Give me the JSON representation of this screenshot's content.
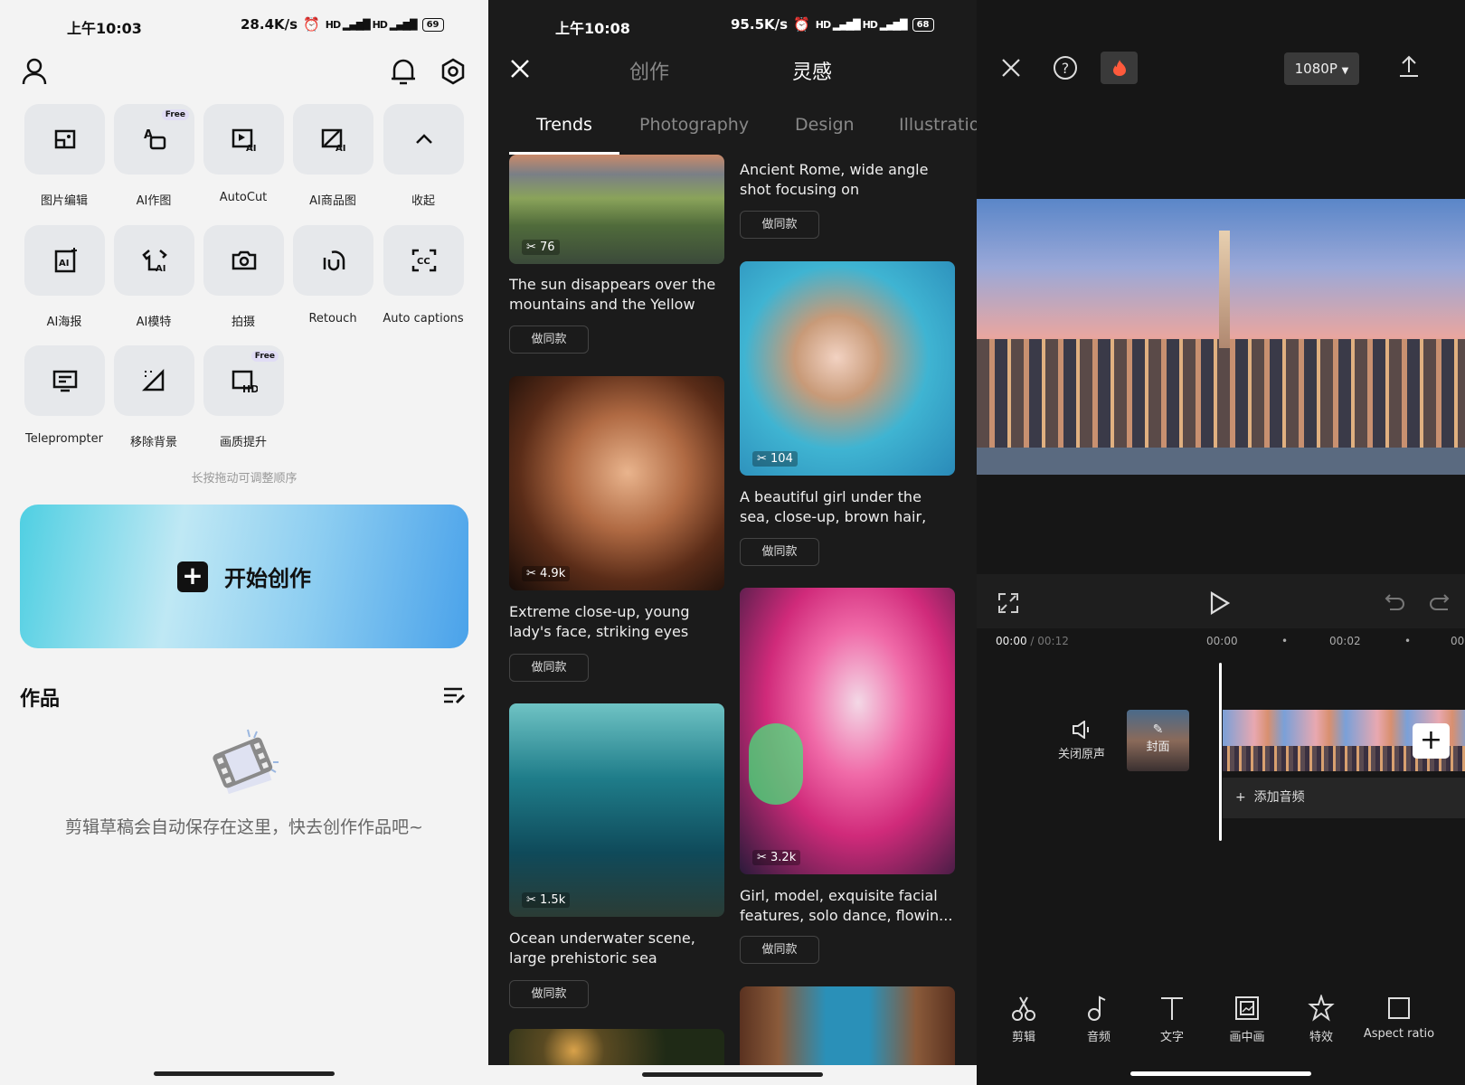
{
  "left": {
    "status": {
      "time": "上午10:03",
      "speed": "28.4K/s",
      "battery": "69"
    },
    "tools": [
      {
        "label": "图片编辑",
        "icon": "image-edit-icon",
        "free": false
      },
      {
        "label": "AI作图",
        "icon": "ai-draw-icon",
        "free": true
      },
      {
        "label": "AutoCut",
        "icon": "autocut-icon",
        "free": false
      },
      {
        "label": "AI商品图",
        "icon": "ai-product-icon",
        "free": false
      },
      {
        "label": "收起",
        "icon": "chevron-up-icon",
        "free": false
      },
      {
        "label": "AI海报",
        "icon": "ai-poster-icon",
        "free": false
      },
      {
        "label": "AI模特",
        "icon": "ai-model-icon",
        "free": false
      },
      {
        "label": "拍摄",
        "icon": "camera-icon",
        "free": false
      },
      {
        "label": "Retouch",
        "icon": "retouch-icon",
        "free": false
      },
      {
        "label": "Auto captions",
        "icon": "captions-icon",
        "free": false
      },
      {
        "label": "Teleprompter",
        "icon": "teleprompter-icon",
        "free": false
      },
      {
        "label": "移除背景",
        "icon": "remove-bg-icon",
        "free": false
      },
      {
        "label": "画质提升",
        "icon": "hd-enhance-icon",
        "free": true
      }
    ],
    "free_badge": "Free",
    "hint": "长按拖动可调整顺序",
    "start_button": "开始创作",
    "works_title": "作品",
    "empty_text": "剪辑草稿会自动保存在这里，快去创作作品吧~"
  },
  "middle": {
    "status": {
      "time": "上午10:08",
      "speed": "95.5K/s",
      "battery": "68"
    },
    "header_tabs": [
      "创作",
      "灵感"
    ],
    "active_header_tab": "灵感",
    "category_tabs": [
      "Trends",
      "Photography",
      "Design",
      "Illustratio"
    ],
    "active_category": "Trends",
    "make_same_label": "做同款",
    "left_cards": [
      {
        "count": "76",
        "text": "The sun disappears over the mountains and the Yellow Ri..."
      },
      {
        "count": "4.9k",
        "text": "Extreme close-up, young lady's face, striking eyes an..."
      },
      {
        "count": "1.5k",
        "text": "Ocean underwater scene, large prehistoric sea creatur..."
      }
    ],
    "right_cards": [
      {
        "text": "Ancient Rome, wide angle shot focusing on magnificen..."
      },
      {
        "count": "104",
        "text": "A beautiful girl under the sea, close-up, brown hair, sunlig..."
      },
      {
        "count": "3.2k",
        "text": "Girl, model, exquisite facial features, solo dance, flowin..."
      }
    ]
  },
  "right": {
    "resolution": "1080P",
    "current_time": "00:00",
    "total_time": "00:12",
    "ruler": [
      "00:00",
      "00:02",
      "00"
    ],
    "mute_label": "关闭原声",
    "cover_label": "封面",
    "add_audio": "添加音频",
    "toolbar": [
      {
        "label": "剪辑",
        "icon": "scissors-icon"
      },
      {
        "label": "音频",
        "icon": "music-note-icon"
      },
      {
        "label": "文字",
        "icon": "text-icon"
      },
      {
        "label": "画中画",
        "icon": "picture-in-picture-icon"
      },
      {
        "label": "特效",
        "icon": "effects-star-icon"
      },
      {
        "label": "Aspect ratio",
        "icon": "aspect-ratio-icon"
      }
    ],
    "accent_fire": "#ff5a3c"
  }
}
